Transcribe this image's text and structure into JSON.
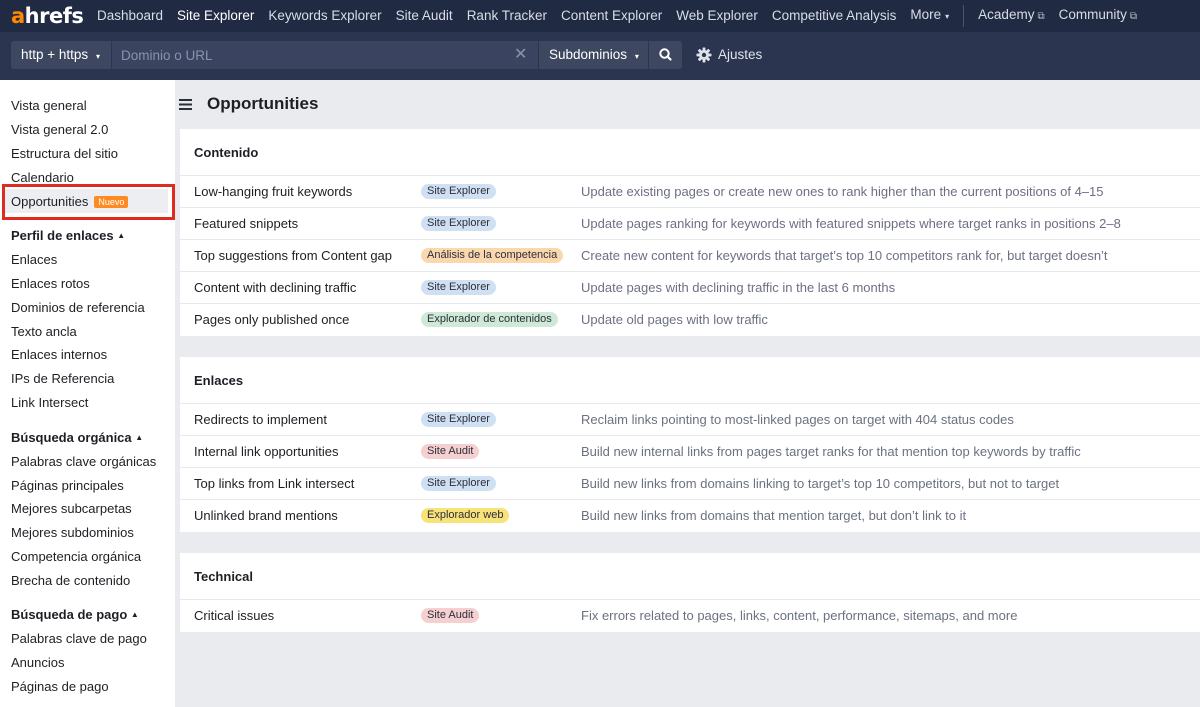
{
  "nav": {
    "logo_a": "a",
    "logo_rest": "hrefs",
    "items": [
      "Dashboard",
      "Site Explorer",
      "Keywords Explorer",
      "Site Audit",
      "Rank Tracker",
      "Content Explorer",
      "Web Explorer",
      "Competitive Analysis",
      "More"
    ],
    "more_caret": "▾",
    "academy": "Academy",
    "community": "Community",
    "external_glyph": "⧉"
  },
  "search": {
    "protocol": "http + https",
    "placeholder": "Dominio o URL",
    "clear_glyph": "✕",
    "scope": "Subdominios",
    "caret": "▾",
    "settings": "Ajustes"
  },
  "sidebar": {
    "overview": [
      "Vista general",
      "Vista general 2.0",
      "Estructura del sitio",
      "Calendario"
    ],
    "opportunities": "Opportunities",
    "new_badge": "Nuevo",
    "backlink_head": "Perfil de enlaces",
    "backlink_items": [
      "Enlaces",
      "Enlaces rotos",
      "Dominios de referencia",
      "Texto ancla",
      "Enlaces internos",
      "IPs de Referencia",
      "Link Intersect"
    ],
    "organic_head": "Búsqueda orgánica",
    "organic_items": [
      "Palabras clave orgánicas",
      "Páginas principales",
      "Mejores subcarpetas",
      "Mejores subdominios",
      "Competencia orgánica",
      "Brecha de contenido"
    ],
    "paid_head": "Búsqueda de pago",
    "paid_items": [
      "Palabras clave de pago",
      "Anuncios",
      "Páginas de pago"
    ],
    "head_caret": "▲"
  },
  "page_title": "Opportunities",
  "sections": [
    {
      "title": "Contenido",
      "rows": [
        {
          "name": "Low-hanging fruit keywords",
          "badge": "Site Explorer",
          "badge_color": "blue",
          "desc": "Update existing pages or create new ones to rank higher than the current positions of 4–15"
        },
        {
          "name": "Featured snippets",
          "badge": "Site Explorer",
          "badge_color": "blue",
          "desc": "Update pages ranking for keywords with featured snippets where target ranks in positions 2–8"
        },
        {
          "name": "Top suggestions from Content gap",
          "badge": "Análisis de la competencia",
          "badge_color": "orange",
          "desc": "Create new content for keywords that target’s top 10 competitors rank for, but target doesn’t"
        },
        {
          "name": "Content with declining traffic",
          "badge": "Site Explorer",
          "badge_color": "blue",
          "desc": "Update pages with declining traffic in the last 6 months"
        },
        {
          "name": "Pages only published once",
          "badge": "Explorador de contenidos",
          "badge_color": "green",
          "desc": "Update old pages with low traffic"
        }
      ]
    },
    {
      "title": "Enlaces",
      "rows": [
        {
          "name": "Redirects to implement",
          "badge": "Site Explorer",
          "badge_color": "blue",
          "desc": "Reclaim links pointing to most-linked pages on target with 404 status codes"
        },
        {
          "name": "Internal link opportunities",
          "badge": "Site Audit",
          "badge_color": "red",
          "desc": "Build new internal links from pages target ranks for that mention top keywords by traffic"
        },
        {
          "name": "Top links from Link intersect",
          "badge": "Site Explorer",
          "badge_color": "blue",
          "desc": "Build new links from domains linking to target’s top 10 competitors, but not to target"
        },
        {
          "name": "Unlinked brand mentions",
          "badge": "Explorador web",
          "badge_color": "yellow",
          "desc": "Build new links from domains that mention target, but don’t link to it"
        }
      ]
    },
    {
      "title": "Technical",
      "rows": [
        {
          "name": "Critical issues",
          "badge": "Site Audit",
          "badge_color": "red",
          "desc": "Fix errors related to pages, links, content, performance, sitemaps, and more"
        }
      ]
    }
  ]
}
